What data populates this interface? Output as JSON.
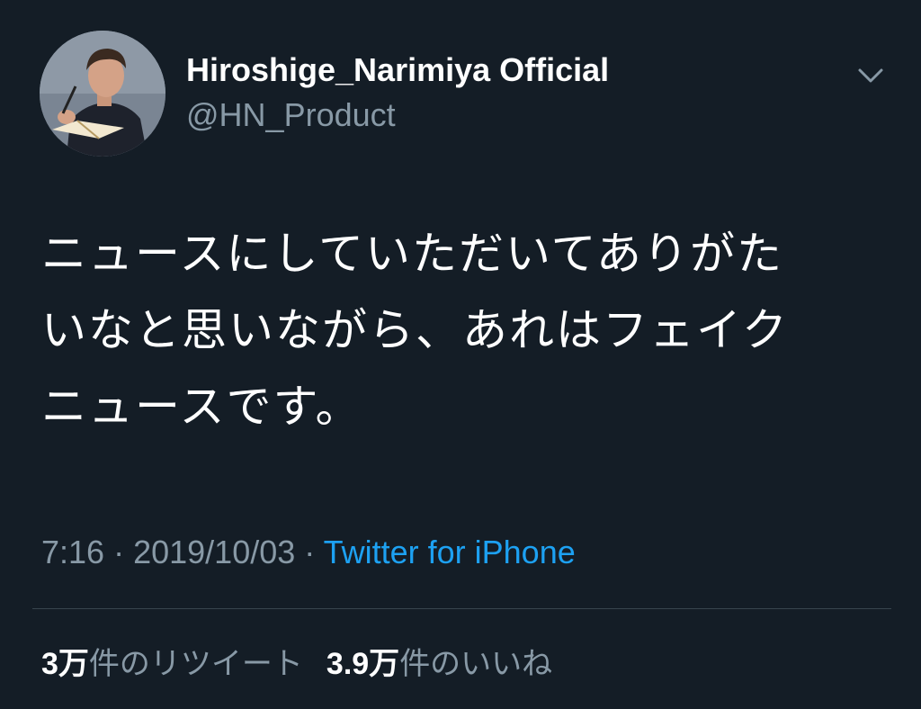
{
  "tweet": {
    "display_name": "Hiroshige_Narimiya Official",
    "handle": "@HN_Product",
    "body_lines": [
      "ニュースにしていただいてありがた",
      "いなと思いながら、あれはフェイク",
      "ニュースです。"
    ],
    "time": "7:16",
    "separator": " · ",
    "date": "2019/10/03",
    "source": "Twitter for iPhone",
    "retweets": {
      "count": "3万",
      "label": "件のリツイート"
    },
    "likes": {
      "count": "3.9万",
      "label": "件のいいね"
    },
    "icons": {
      "more": "chevron-down-icon",
      "avatar": "profile-photo"
    }
  },
  "colors": {
    "background": "#141d26",
    "text_primary": "#ffffff",
    "text_secondary": "#8899a6",
    "link": "#1da1f2",
    "divider": "#38444d"
  }
}
